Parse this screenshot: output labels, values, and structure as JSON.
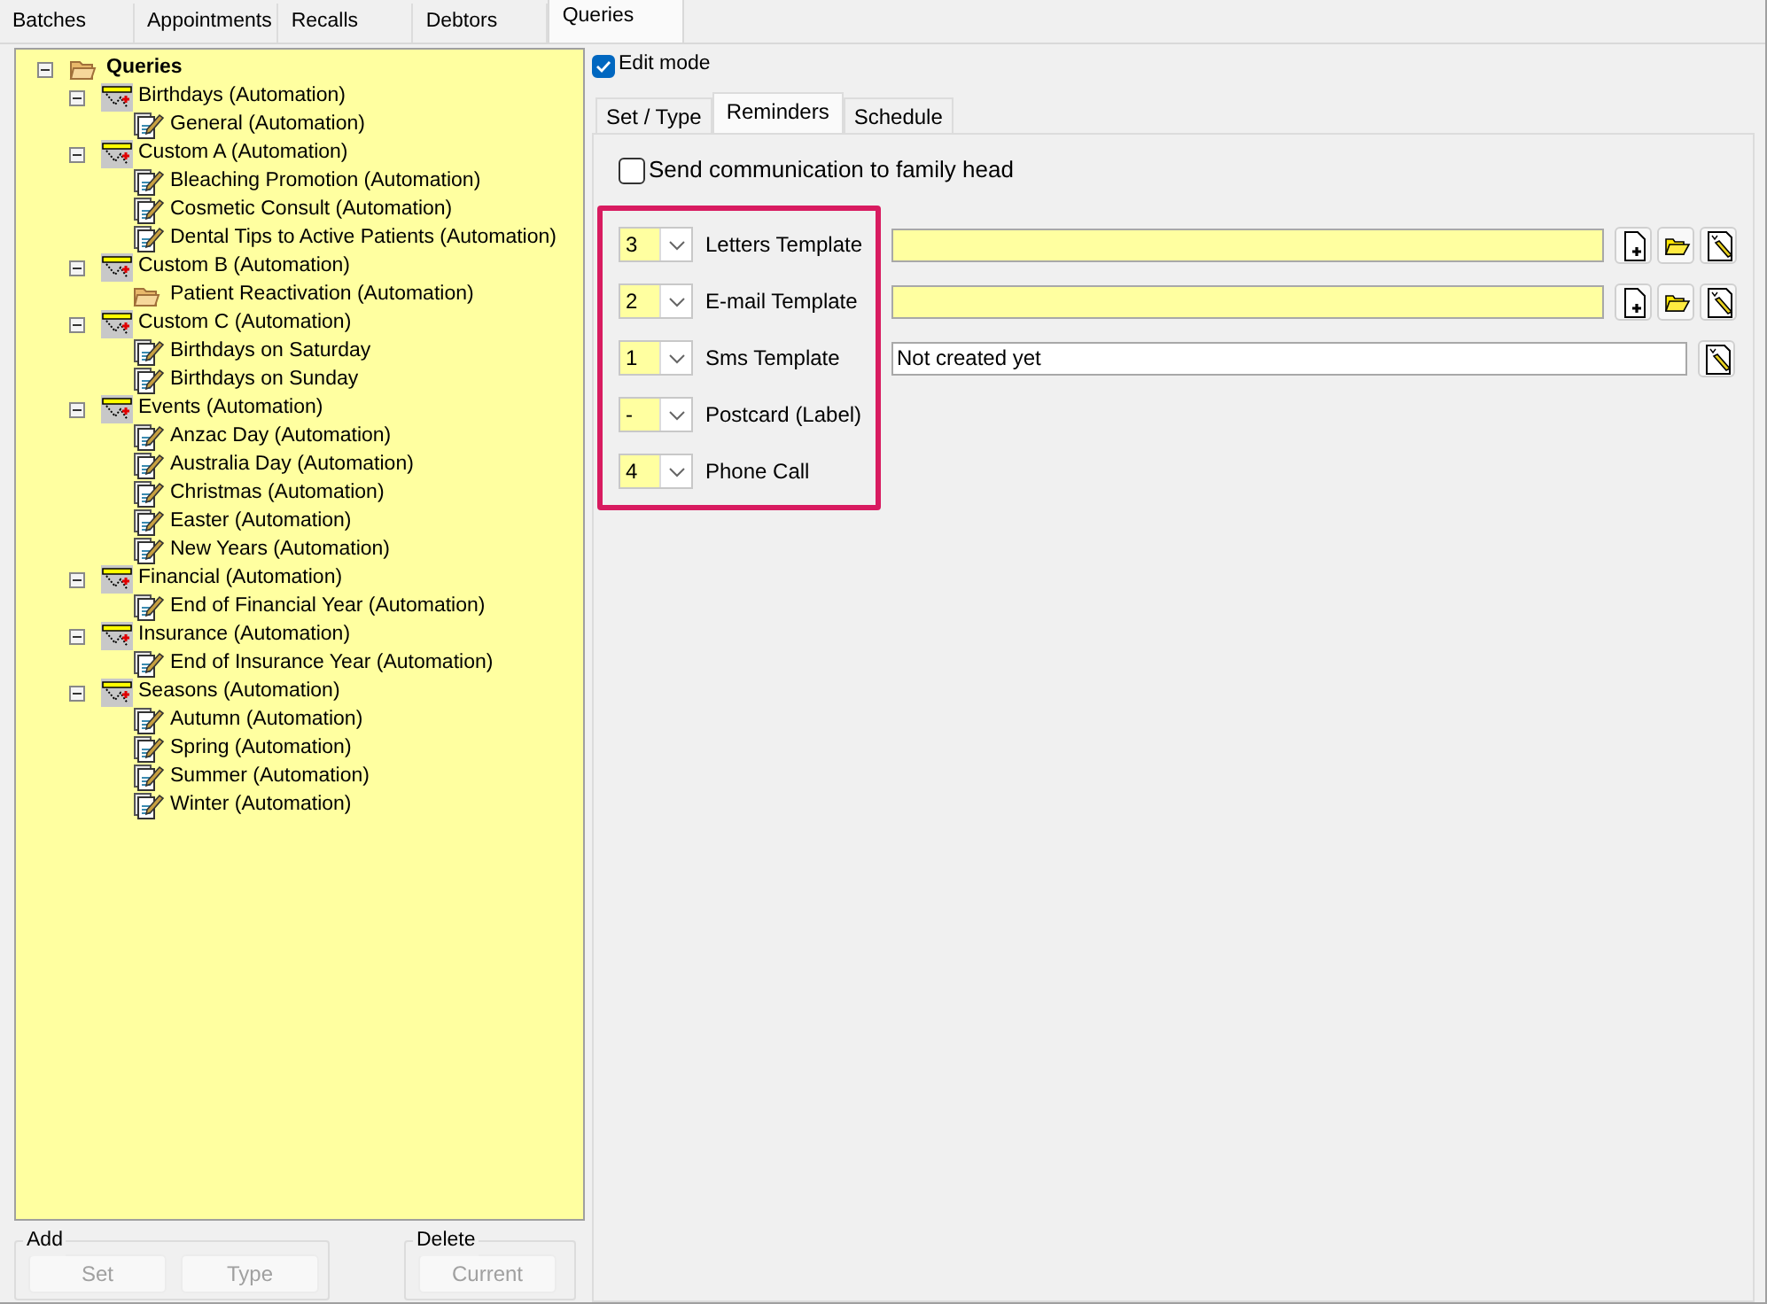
{
  "tabs": [
    {
      "label": "Batches",
      "selected": false
    },
    {
      "label": "Appointments",
      "selected": false
    },
    {
      "label": "Recalls",
      "selected": false
    },
    {
      "label": "Debtors",
      "selected": false
    },
    {
      "label": "Queries",
      "selected": true
    }
  ],
  "tree": [
    {
      "label": "Queries",
      "kind": "folder",
      "expanded": true,
      "children": [
        {
          "label": "Birthdays (Automation)",
          "kind": "group",
          "expanded": true,
          "children": [
            {
              "label": "General (Automation)",
              "kind": "query"
            }
          ]
        },
        {
          "label": "Custom A (Automation)",
          "kind": "group",
          "expanded": true,
          "children": [
            {
              "label": "Bleaching Promotion (Automation)",
              "kind": "query"
            },
            {
              "label": "Cosmetic Consult (Automation)",
              "kind": "query"
            },
            {
              "label": "Dental Tips to Active Patients (Automation)",
              "kind": "query"
            }
          ]
        },
        {
          "label": "Custom B (Automation)",
          "kind": "group",
          "expanded": true,
          "children": [
            {
              "label": "Patient Reactivation (Automation)",
              "kind": "folder"
            }
          ]
        },
        {
          "label": "Custom C (Automation)",
          "kind": "group",
          "expanded": true,
          "children": [
            {
              "label": "Birthdays on Saturday",
              "kind": "query"
            },
            {
              "label": "Birthdays on Sunday",
              "kind": "query"
            }
          ]
        },
        {
          "label": "Events (Automation)",
          "kind": "group",
          "expanded": true,
          "children": [
            {
              "label": "Anzac Day (Automation)",
              "kind": "query"
            },
            {
              "label": "Australia Day (Automation)",
              "kind": "query"
            },
            {
              "label": "Christmas (Automation)",
              "kind": "query"
            },
            {
              "label": "Easter (Automation)",
              "kind": "query"
            },
            {
              "label": "New Years (Automation)",
              "kind": "query"
            }
          ]
        },
        {
          "label": "Financial (Automation)",
          "kind": "group",
          "expanded": true,
          "children": [
            {
              "label": "End of Financial Year (Automation)",
              "kind": "query"
            }
          ]
        },
        {
          "label": "Insurance (Automation)",
          "kind": "group",
          "expanded": true,
          "children": [
            {
              "label": "End of Insurance Year (Automation)",
              "kind": "query"
            }
          ]
        },
        {
          "label": "Seasons (Automation)",
          "kind": "group",
          "expanded": true,
          "children": [
            {
              "label": "Autumn (Automation)",
              "kind": "query"
            },
            {
              "label": "Spring (Automation)",
              "kind": "query"
            },
            {
              "label": "Summer (Automation)",
              "kind": "query"
            },
            {
              "label": "Winter (Automation)",
              "kind": "query"
            }
          ]
        }
      ]
    }
  ],
  "add_group": {
    "legend": "Add",
    "buttons": [
      {
        "label": "Set",
        "disabled": true
      },
      {
        "label": "Type",
        "disabled": true
      }
    ]
  },
  "delete_group": {
    "legend": "Delete",
    "buttons": [
      {
        "label": "Current",
        "disabled": true
      }
    ]
  },
  "edit_mode": {
    "label": "Edit mode",
    "checked": true
  },
  "subtabs": [
    {
      "label": "Set / Type",
      "selected": false
    },
    {
      "label": "Reminders",
      "selected": true
    },
    {
      "label": "Schedule",
      "selected": false
    }
  ],
  "family_head": {
    "label": "Send communication to family head",
    "checked": false
  },
  "reminders": [
    {
      "order": "3",
      "label": "Letters Template",
      "kind": "template",
      "buttons": [
        {
          "kind": "new"
        },
        {
          "kind": "open"
        },
        {
          "kind": "edit"
        }
      ]
    },
    {
      "order": "2",
      "label": "E-mail Template",
      "kind": "template",
      "buttons": [
        {
          "kind": "new"
        },
        {
          "kind": "open"
        },
        {
          "kind": "edit"
        }
      ]
    },
    {
      "order": "1",
      "label": "Sms Template",
      "kind": "text",
      "value": "Not created yet",
      "buttons": [
        {
          "kind": "edit"
        }
      ]
    },
    {
      "order": "-",
      "label": "Postcard (Label)",
      "kind": "none"
    },
    {
      "order": "4",
      "label": "Phone Call",
      "kind": "none"
    }
  ]
}
